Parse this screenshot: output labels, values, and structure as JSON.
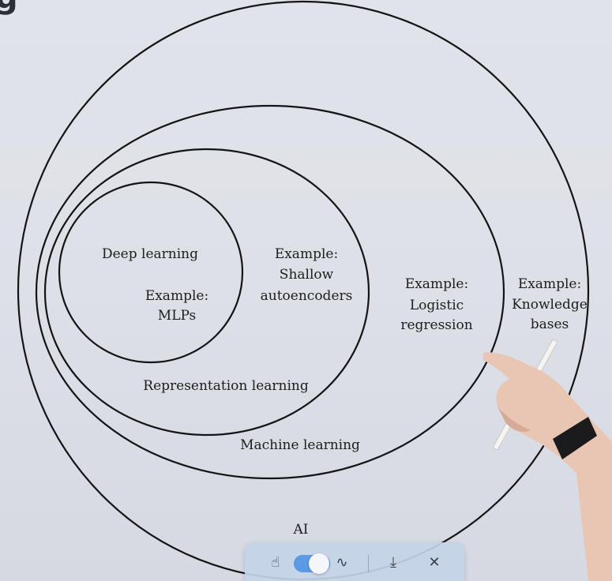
{
  "diagram": {
    "sets": [
      {
        "id": "ai",
        "label": "AI",
        "example": [
          "Example:",
          "Knowledge",
          "bases"
        ]
      },
      {
        "id": "machine-learning",
        "label": "Machine learning",
        "example": [
          "Example:",
          "Logistic",
          "regression"
        ]
      },
      {
        "id": "representation-learning",
        "label": "Representation learning",
        "example": [
          "Example:",
          "Shallow",
          "autoencoders"
        ]
      },
      {
        "id": "deep-learning",
        "label": "Deep learning",
        "example": [
          "Example:",
          "MLPs"
        ]
      }
    ],
    "corner_glyph": "g"
  },
  "toolbar": {
    "icons": {
      "hand": "hand-pointer-icon",
      "toggle": "mode-toggle",
      "pen": "pen-stroke-icon",
      "download": "download-icon",
      "close": "close-icon"
    },
    "glyphs": {
      "hand": "☝",
      "pen": "∿",
      "download": "⤓",
      "close": "✕"
    },
    "captions": {
      "hand": "",
      "pen": "",
      "download": "",
      "close": ""
    },
    "colors": {
      "background": "#c4d4e8",
      "toggle_on": "#5d9ae6"
    }
  }
}
